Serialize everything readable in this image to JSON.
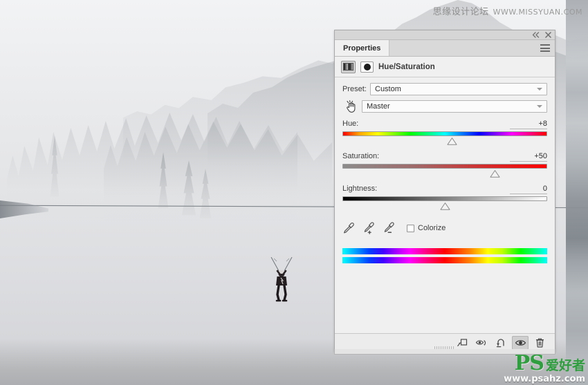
{
  "app": {
    "panel_title": "Properties",
    "adjustment_title": "Hue/Saturation"
  },
  "titlebar": {
    "collapse_label": "◂◂",
    "close_label": "✕",
    "menu_icon": "hamburger-menu-icon"
  },
  "preset": {
    "label": "Preset:",
    "value": "Custom",
    "caret_icon": "chevron-down-icon"
  },
  "channel": {
    "tool_icon": "targeted-adjustment-hand-icon",
    "value": "Master",
    "caret_icon": "chevron-down-icon"
  },
  "sliders": [
    {
      "name": "hue",
      "label": "Hue:",
      "value": "+8",
      "thumb_percent": 53.5,
      "range": [
        -180,
        180
      ],
      "numeric": 8
    },
    {
      "name": "saturation",
      "label": "Saturation:",
      "value": "+50",
      "thumb_percent": 74.5,
      "range": [
        -100,
        100
      ],
      "numeric": 50
    },
    {
      "name": "lightness",
      "label": "Lightness:",
      "value": "0",
      "thumb_percent": 50.0,
      "range": [
        -100,
        100
      ],
      "numeric": 0
    }
  ],
  "tools": {
    "eyedropper": "eyedropper-icon",
    "eyedropper_add": "eyedropper-plus-icon",
    "eyedropper_subtract": "eyedropper-minus-icon",
    "colorize_label": "Colorize",
    "colorize_checked": false
  },
  "footer": {
    "buttons": [
      {
        "name": "clip-to-layer-button",
        "icon": "clip-to-layer-icon",
        "active": false
      },
      {
        "name": "toggle-preview-layer-button",
        "icon": "eye-arrow-icon",
        "active": false
      },
      {
        "name": "reset-adjustment-button",
        "icon": "reset-arrow-icon",
        "active": false
      },
      {
        "name": "toggle-layer-visibility-button",
        "icon": "eye-icon",
        "active": true
      },
      {
        "name": "delete-adjustment-button",
        "icon": "trash-icon",
        "active": false
      }
    ]
  },
  "watermarks": {
    "top_cn": "思缘设计论坛",
    "top_url": "WWW.MISSYUAN.COM",
    "bottom_brand": "PS",
    "bottom_cn": "爱好者",
    "bottom_url": "www.psahz.com"
  },
  "canvas": {
    "scene": "foggy-mountain-zipline-photo",
    "rider": "zipline-rider-silhouette",
    "cable": "zipline-cable"
  },
  "colors": {
    "panel_bg": "#f0f0f0",
    "panel_border": "#a9a9a9",
    "tab_bg": "#d9d9d9",
    "text": "#3c3c3c",
    "accent_green": "#2f9e3e",
    "saturation_end": "#ff0000"
  }
}
